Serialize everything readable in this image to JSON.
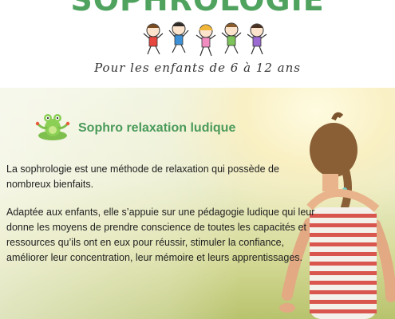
{
  "header": {
    "title": "SOPHROLOGIE",
    "subtitle": "Pour les enfants de 6 à 12 ans"
  },
  "content": {
    "heading": "Sophro relaxation ludique",
    "paragraph1": "La sophrologie est une méthode de relaxation qui possède de nombreux bienfaits.",
    "paragraph2": "Adaptée aux enfants, elle s’appuie sur une pédagogie ludique qui leur donne les moyens de prendre conscience de toutes les capacités et ressources qu’ils ont en eux pour réussir, stimuler la confiance, améliorer leur concentration, leur mémoire et leurs apprentissages."
  },
  "colors": {
    "title_green": "#4fa35f",
    "heading_green": "#4a9a5a",
    "text": "#1e1e1e"
  },
  "icons": [
    "jumping-kids-illustration",
    "meditating-frog-icon",
    "meditating-girl-photo"
  ]
}
